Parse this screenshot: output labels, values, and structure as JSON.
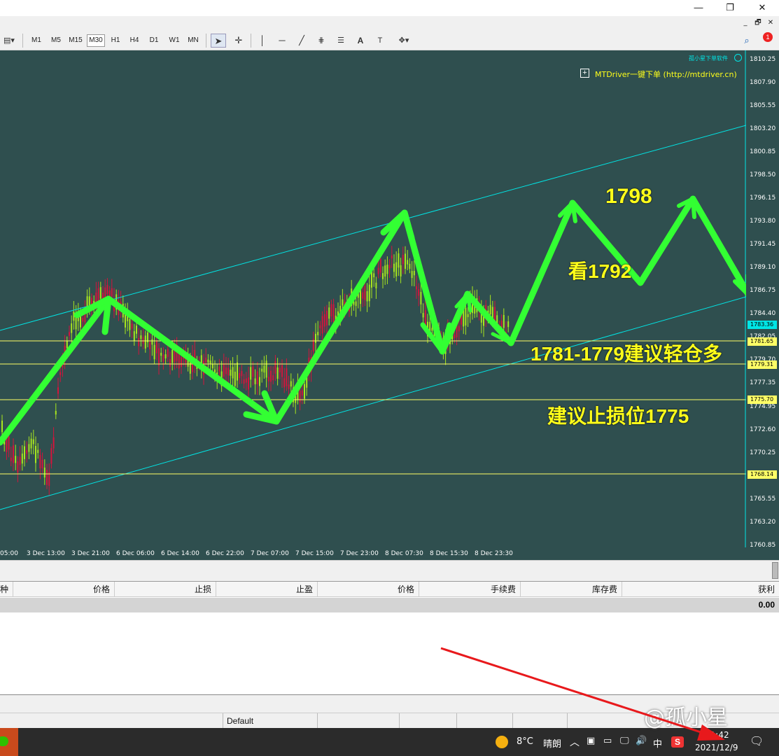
{
  "window": {
    "minimize": "—",
    "restore": "❐",
    "close": "✕",
    "mdi_min": "_",
    "mdi_restore": "🗗",
    "mdi_close": "✕"
  },
  "toolbar": {
    "timeframes": [
      "M1",
      "M5",
      "M15",
      "M30",
      "H1",
      "H4",
      "D1",
      "W1",
      "MN"
    ],
    "active_timeframe": "M30",
    "tools": [
      "cursor-icon",
      "crosshair-icon",
      "vertical-line-icon",
      "horizontal-line-icon",
      "trendline-icon",
      "fibonacci-icon",
      "channel-icon",
      "text-icon",
      "label-icon",
      "arrows-icon"
    ],
    "search_icon": "🔍",
    "notification_count": "1"
  },
  "chart": {
    "top_right_label": "孤小星下单软件",
    "plugin_label": "MTDriver一键下单 (http://mtdriver.cn)",
    "plugin_icon": "+",
    "price_labels": [
      "1810.25",
      "1807.90",
      "1805.55",
      "1803.20",
      "1800.85",
      "1798.50",
      "1796.15",
      "1793.80",
      "1791.45",
      "1789.10",
      "1786.75",
      "1784.40",
      "1782.05",
      "1779.70",
      "1777.35",
      "1774.95",
      "1772.60",
      "1770.25",
      "1767.90",
      "1765.55",
      "1763.20",
      "1760.85"
    ],
    "levels": [
      {
        "price": "1783.36",
        "color": "#00e5e5"
      },
      {
        "price": "1781.65",
        "color": "#ffff66"
      },
      {
        "price": "1779.31",
        "color": "#ffff66"
      },
      {
        "price": "1775.70",
        "color": "#ffff66"
      },
      {
        "price": "1768.14",
        "color": "#ffff66"
      }
    ],
    "time_labels": [
      "05:00",
      "3 Dec 13:00",
      "3 Dec 21:00",
      "6 Dec 06:00",
      "6 Dec 14:00",
      "6 Dec 22:00",
      "7 Dec 07:00",
      "7 Dec 15:00",
      "7 Dec 23:00",
      "8 Dec 07:30",
      "8 Dec 15:30",
      "8 Dec 23:30"
    ],
    "annotations": {
      "target_high": "1798",
      "target_mid": "看1792",
      "entry": "1781-1779建议轻仓多",
      "stop": "建议止损位1775"
    },
    "colors": {
      "bg": "#2f4f4f",
      "bull": "#a8e61e",
      "bear": "#d4143c",
      "channel": "#00e5e5",
      "arrow": "#33ff33",
      "level": "#ffff66"
    }
  },
  "terminal": {
    "columns": [
      "种",
      "价格",
      "止损",
      "止盈",
      "价格",
      "手续费",
      "库存费",
      "获利"
    ],
    "profit_total": "0.00"
  },
  "statusbar": {
    "profile": "Default"
  },
  "taskbar": {
    "weather_temp": "8°C",
    "weather_text": "晴朗",
    "ime": "中",
    "time": "11:42",
    "date": "2021/12/9",
    "watermark": "@孤小星"
  }
}
